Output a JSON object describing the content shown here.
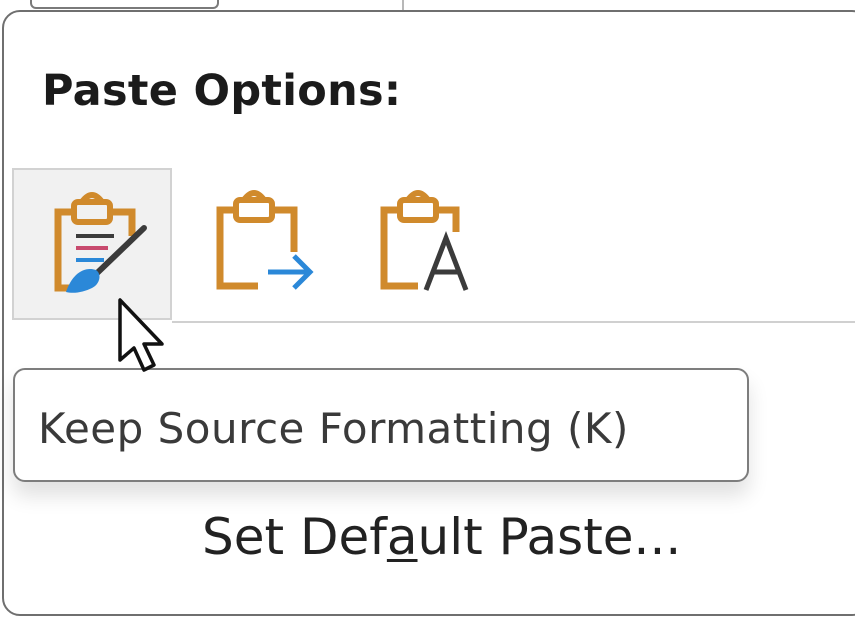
{
  "menu": {
    "heading": "Paste Options:",
    "options": [
      {
        "icon": "keep-source-formatting-icon",
        "active": true
      },
      {
        "icon": "merge-formatting-icon",
        "active": false
      },
      {
        "icon": "keep-text-only-icon",
        "active": false
      }
    ],
    "tooltip": "Keep Source Formatting (K)",
    "set_default": {
      "before": "Set Def",
      "access_key": "a",
      "after": "ult Paste..."
    }
  },
  "colors": {
    "clipboard_orange": "#D08A2C",
    "arrow_blue": "#2B88D8",
    "brush_dark": "#3B3B3B",
    "active_bg": "#F1F1F1"
  }
}
